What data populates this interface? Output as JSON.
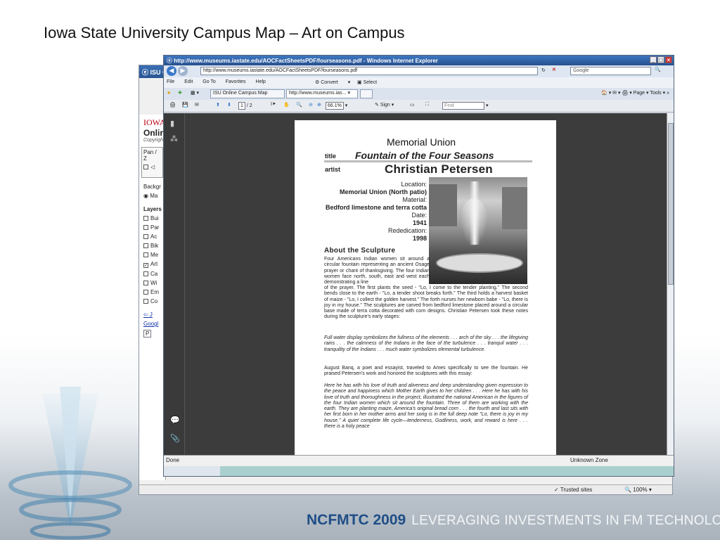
{
  "slide": {
    "title": "Iowa State University Campus Map – Art on Campus",
    "footer_brand": "NCFMTC 2009",
    "footer_tagline": "LEVERAGING INVESTMENTS IN FM TECHNOLOGY"
  },
  "back_window": {
    "title": "ISU On",
    "sidebar": {
      "logo": "IOWA",
      "heading": "Onlir",
      "copyright": "Copyrigh",
      "pan_label": "Pan / Z",
      "background_label": "Backgr",
      "background_option": "Ma",
      "layers_label": "Layers",
      "layers": [
        {
          "label": "Bui",
          "checked": false
        },
        {
          "label": "Par",
          "checked": false
        },
        {
          "label": "Ac",
          "checked": false
        },
        {
          "label": "Bik",
          "checked": false
        },
        {
          "label": "Me",
          "checked": false
        },
        {
          "label": "Art",
          "checked": true
        },
        {
          "label": "Ca",
          "checked": false
        },
        {
          "label": "Wi",
          "checked": false
        },
        {
          "label": "Em",
          "checked": false
        },
        {
          "label": "Co",
          "checked": false
        }
      ],
      "link1": "⇦ J",
      "link2": "Googl",
      "button": "P"
    },
    "status_trusted": "Trusted sites",
    "status_zoom": "100%"
  },
  "ie_window": {
    "title": "http://www.museums.iastate.edu/AOCFactSheetsPDF/fourseasons.pdf - Windows Internet Explorer",
    "address": "http://www.museums.iastate.edu/AOCFactSheetsPDF/fourseasons.pdf",
    "search_placeholder": "Google",
    "menu": [
      "File",
      "Edit",
      "Go To",
      "Favorites",
      "Help"
    ],
    "convert_label": "Convert",
    "select_label": "Select",
    "tabs": [
      {
        "label": "ISU Online Campus Map"
      },
      {
        "label": "http://www.museums.ias..."
      }
    ],
    "tab_right": "Page ▾  Tools ▾",
    "pdf_toolbar": {
      "page_current": "1",
      "page_total": "/ 2",
      "zoom": "66.1%",
      "sign_label": "Sign",
      "find_placeholder": "Find"
    },
    "status_left": "Done",
    "map_label": "Unknown Zone"
  },
  "pdf_page": {
    "heading": "Memorial Union",
    "title_label": "title",
    "title": "Fountain of the Four Seasons",
    "artist_label": "artist",
    "artist": "Christian Petersen",
    "info": [
      {
        "k": "Location:",
        "v": "Memorial Union (North patio)"
      },
      {
        "k": "Material:",
        "v": "Bedford limestone and terra cotta"
      },
      {
        "k": "Date:",
        "v": "1941"
      },
      {
        "k": "Rededication:",
        "v": "1998"
      }
    ],
    "about_heading": "About the Sculpture",
    "para1": "Four Americans Indian women sit around a circular fountain representing an ancient Osage prayer or chant of thanksgiving. The four Indian women face north, south, east and west each demonstrating a line of the prayer. The first plants the seed - \"Lo, I come to the tender planting.\" The second bends close to the earth - \"Lo, a tender shoot breaks forth.\" The third holds a harvest basket of maize - \"Lo, I collect the golden harvest.\" The forth nurses her newborn babe - \"Lo, there is joy in my house.\" The sculptures are carved from bedford limestone placed around a circular base made of terra cotta decorated with corn designs. Christian Petersen took these notes during the sculpture's early stages:",
    "para2": "Full water display symbolizes the fullness of the elements . . . arch of the sky . . . the lifegiving rains . . . the calmness of the Indians in the face of the turbulence . . . tranquil water . . . tranquility of the Indians . . . much water symbolizes elemental turbulence.",
    "para3": "August Banq, a poet and essayist, traveled to Ames specifically to see the fountain. He praised Petersen's work and honored the sculptures with this essay:",
    "para4": "Here he has with his love of truth and aliveness and deep understanding given expression to the peace and happiness which Mother Earth gives to her children . . . Here he has with his love of truth and thoroughness in the project, illustrated the national American in the figures of the four Indian women which sit around the fountain. Three of them are working with the earth. They are planting maize, America's original bread corn . . . the fourth and last sits with her first born in her mother arms and her song is in the full deep note \"Lo, there is joy in my house.\" A quiet complete life cycle—tenderness, Godliness, work, and reward is here . . . there is a holy peace"
  }
}
